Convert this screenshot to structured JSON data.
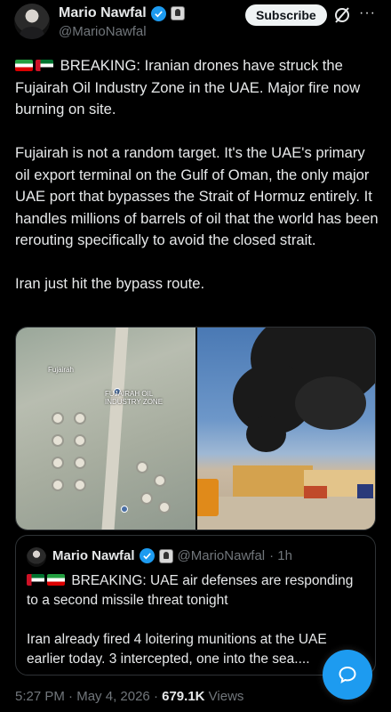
{
  "author": {
    "name": "Mario Nawfal",
    "handle": "@MarioNawfal",
    "subscribe_label": "Subscribe",
    "more_label": "···"
  },
  "tweet": {
    "paragraphs": [
      "BREAKING: Iranian drones have struck the Fujairah Oil Industry Zone in the UAE. Major fire now burning on site.",
      "Fujairah is not a random target. It's the UAE's primary oil export terminal on the Gulf of Oman, the only major UAE port that bypasses the Strait of Hormuz entirely. It handles millions of barrels of oil that the world has been rerouting specifically to avoid the closed strait.",
      "Iran just hit the bypass route."
    ]
  },
  "media": {
    "map_labels": [
      "FUJAIRAH OIL INDUSTRY ZONE",
      "Fujairah"
    ]
  },
  "quote": {
    "name": "Mario Nawfal",
    "handle": "@MarioNawfal",
    "time": "· 1h",
    "paragraphs": [
      "BREAKING: UAE air defenses are responding to a second missile threat tonight",
      "Iran already fired 4 loitering munitions at the UAE earlier today. 3 intercepted, one into the sea...."
    ]
  },
  "meta": {
    "time": "5:27 PM",
    "date": "May 4, 2026",
    "views_count": "679.1K",
    "views_label": "Views"
  },
  "colors": {
    "accent": "#1d9bf0",
    "background": "#000000",
    "muted": "#71767b"
  }
}
